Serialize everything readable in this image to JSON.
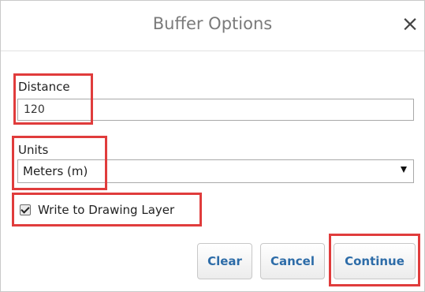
{
  "dialog": {
    "title": "Buffer Options",
    "close_icon": "×"
  },
  "distance": {
    "label": "Distance",
    "value": "120"
  },
  "units": {
    "label": "Units",
    "selected": "Meters (m)"
  },
  "write_to_drawing_layer": {
    "label": "Write to Drawing Layer",
    "checked": true
  },
  "buttons": {
    "clear": "Clear",
    "cancel": "Cancel",
    "continue": "Continue"
  },
  "colors": {
    "highlight": "#e03c3c",
    "button_text": "#2d6ca8"
  }
}
